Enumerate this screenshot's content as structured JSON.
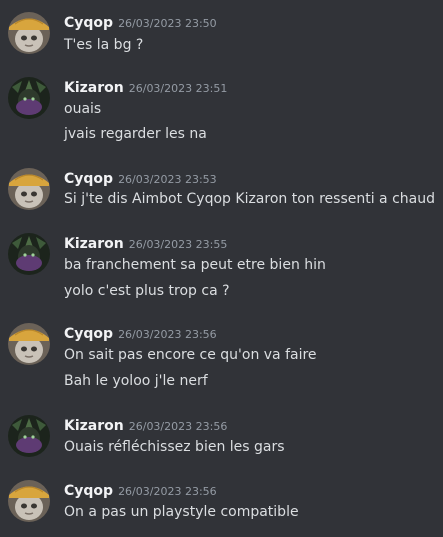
{
  "messages": [
    {
      "author": "Cyqop",
      "avatar": "cyqop-avatar",
      "timestamp": "26/03/2023 23:50",
      "lines": [
        "T'es la bg ?"
      ]
    },
    {
      "author": "Kizaron",
      "avatar": "kizaron-avatar",
      "timestamp": "26/03/2023 23:51",
      "lines": [
        "ouais",
        "jvais regarder les na"
      ]
    },
    {
      "author": "Cyqop",
      "avatar": "cyqop-avatar",
      "timestamp": "26/03/2023 23:53",
      "lines": [
        "Si j'te dis Aimbot Cyqop Kizaron ton ressenti a chaud"
      ]
    },
    {
      "author": "Kizaron",
      "avatar": "kizaron-avatar",
      "timestamp": "26/03/2023 23:55",
      "lines": [
        "ba franchement sa peut etre bien hin",
        "yolo c'est plus trop ca ?"
      ]
    },
    {
      "author": "Cyqop",
      "avatar": "cyqop-avatar",
      "timestamp": "26/03/2023 23:56",
      "lines": [
        "On sait pas encore ce qu'on va faire",
        "Bah le yoloo j'le nerf"
      ]
    },
    {
      "author": "Kizaron",
      "avatar": "kizaron-avatar",
      "timestamp": "26/03/2023 23:56",
      "lines": [
        "Ouais réfléchissez bien les gars"
      ]
    },
    {
      "author": "Cyqop",
      "avatar": "cyqop-avatar",
      "timestamp": "26/03/2023 23:56",
      "lines": [
        "On a pas un playstyle compatible"
      ]
    }
  ],
  "colors": {
    "background": "#313338",
    "username": "#f2f3f5",
    "timestamp": "#949ba4",
    "text": "#dbdee1"
  }
}
